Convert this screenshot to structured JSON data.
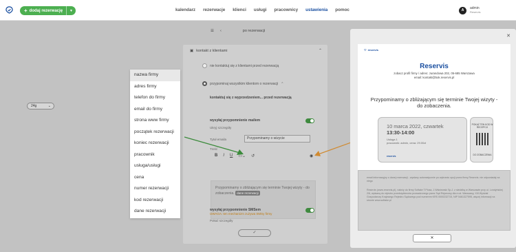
{
  "topbar": {
    "add_label": "dodaj rezerwację",
    "nav": [
      "kalendarz",
      "rezerwacje",
      "klienci",
      "usługi",
      "pracownicy",
      "ustawienia",
      "pomoc"
    ],
    "active_nav": "ustawienia",
    "user_initial": "A",
    "user_name": "admin",
    "user_company": "Reservis"
  },
  "crumbs": {
    "title": "po rezerwacji"
  },
  "panel": {
    "section": "kontakt z klientami",
    "radio_off": "nie kontaktuj się z klientami przed rezerwacją",
    "radio_on": "przypominaj wszystkim klientom o rezerwacji",
    "advance_label": "kontaktuj się z wyprzedzeniem... przed rezerwacją",
    "advance_value": "24g",
    "email_toggle_label": "wysyłaj przypomnienie mailem",
    "email_details": "Ukryj szczegóły",
    "subject_label": "Tytuł emaila",
    "subject_value": "Przypominamy o wizycie",
    "content_label": "Treść",
    "editor_text": "Przypominamy o zbliżającym się terminie Twojej wizyty - do zobaczenia.",
    "editor_tag": "dane rezerwacji",
    "sms_toggle_label": "wysyłaj przypomnienie SMSem",
    "sms_warning": "UWAGA: ten mechanizm zużywa SMSy firmy",
    "sms_details": "Pokaż szczegóły",
    "confirm": "✓"
  },
  "variables": [
    "nazwa firmy",
    "adres firmy",
    "telefon do firmy",
    "email do firmy",
    "strona www firmy",
    "początek rezerwacji",
    "koniec rezerwacji",
    "pracownik",
    "usługa/usługi",
    "cena",
    "numer rezerwacji",
    "kod rezerwacji",
    "dane rezerwacji"
  ],
  "preview": {
    "logo_text": "reservis",
    "title": "Reservis",
    "subtitle_1": "zobacz profil firmy / adres: Jurandowa 202, 05-685 Warszawa",
    "subtitle_2": "email: kontakt@bok.reservis.pl",
    "message": "Przypominamy o zbliżającym się terminie Twojej wizyty - do zobaczenia.",
    "ticket_date": "10 marca 2022, czwartek",
    "ticket_time": "13:30-14:00",
    "ticket_service": "Usługa 1",
    "ticket_details": "pracownik: admin, cena: 29.00zł",
    "ticket_logo": "reservis",
    "ticket_right_top": "POKAŻ TEN KOD W RECEPCJI",
    "ticket_right_bot": "DO ZOBACZENIA",
    "footer_1": "email informacyjny o danej rezerwacji - wysłany automatycznie po wybraniu opcji przez firmę Reservis. nie odpowiadaj na niego",
    "footer_2": "Reservis (www.reservis.pl), należy do firmy Softake T.Piosa, J.Wiśniewski Sp.J. z siedzibą w Warszawie przy ul. Londyńskiej 2/6, wpisaną do rejestru przedsiębiorców prowadzonego przez Sąd Rejonowy dla m.st. Warszawy, XIII Wydział Gospodarczy Krajowego Rejestru Sądowego pod numerem KRS 0000232715, NIP 5461327595, więcej informacji na stronie www.softake.pl",
    "close": "✕"
  }
}
